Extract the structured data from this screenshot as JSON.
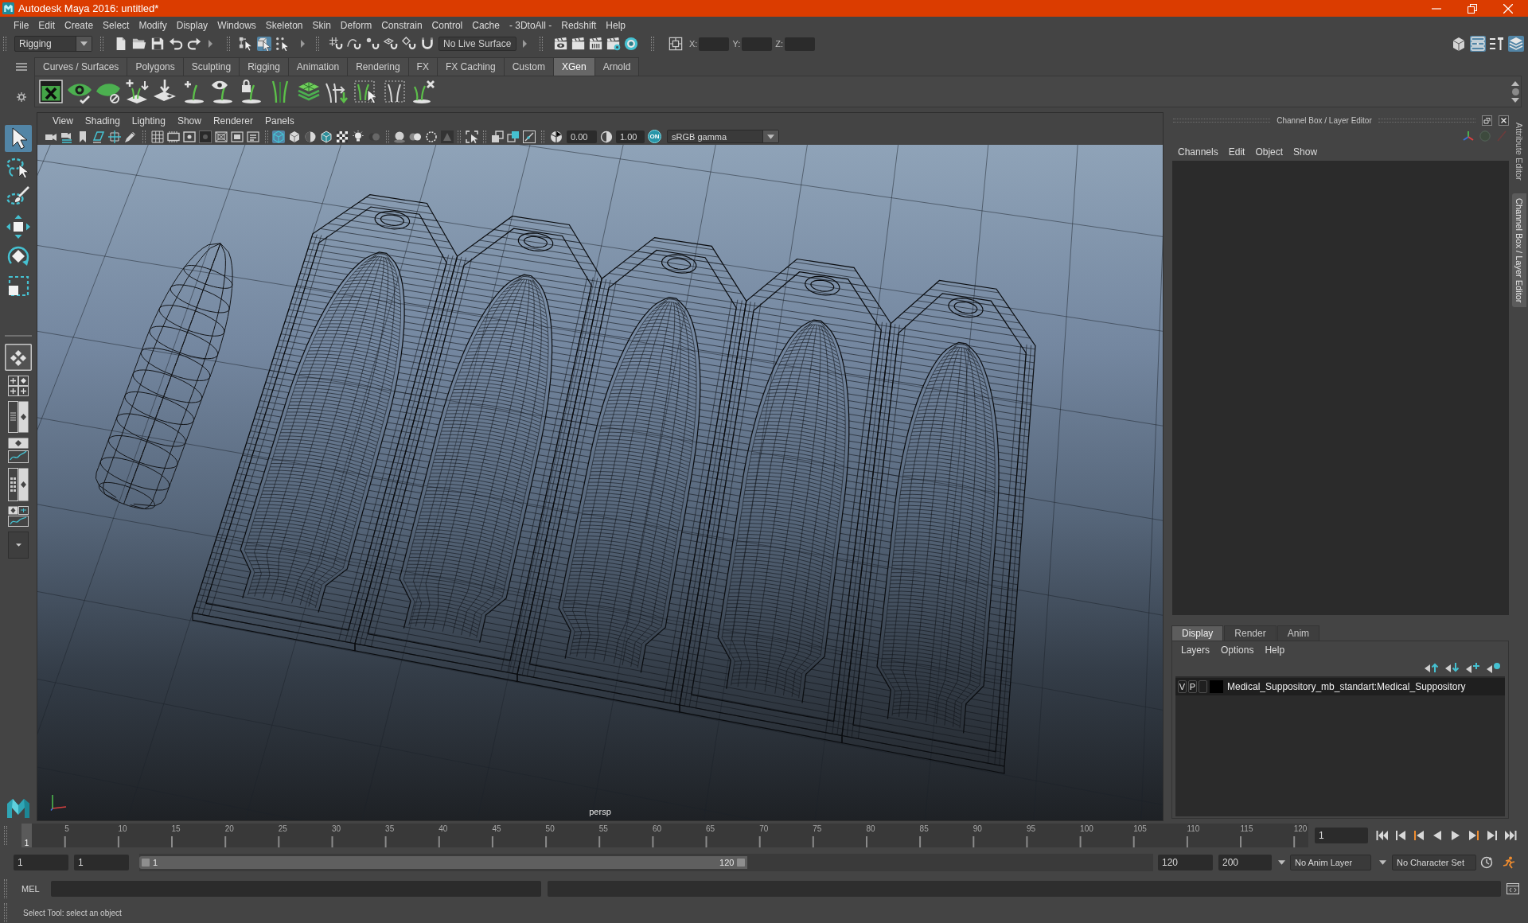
{
  "window": {
    "title": "Autodesk Maya 2016: untitled*"
  },
  "menu_bar": [
    "File",
    "Edit",
    "Create",
    "Select",
    "Modify",
    "Display",
    "Windows",
    "Skeleton",
    "Skin",
    "Deform",
    "Constrain",
    "Control",
    "Cache",
    "- 3DtoAll -",
    "Redshift",
    "Help"
  ],
  "status_line": {
    "menu_set": "Rigging",
    "selection_modes": [
      {
        "selected": false
      },
      {
        "selected": true
      },
      {
        "selected": false
      }
    ],
    "live_surface": "No Live Surface",
    "coordinate_fields": [
      {
        "label": "X:"
      },
      {
        "label": "Y:"
      },
      {
        "label": "Z:"
      }
    ],
    "panel_toggles": [
      {
        "selected": false
      },
      {
        "selected": true
      },
      {
        "selected": false
      },
      {
        "selected": true
      }
    ]
  },
  "shelf": {
    "tabs": [
      {
        "label": "Curves / Surfaces",
        "selected": false
      },
      {
        "label": "Polygons",
        "selected": false
      },
      {
        "label": "Sculpting",
        "selected": false
      },
      {
        "label": "Rigging",
        "selected": false
      },
      {
        "label": "Animation",
        "selected": false
      },
      {
        "label": "Rendering",
        "selected": false
      },
      {
        "label": "FX",
        "selected": false
      },
      {
        "label": "FX Caching",
        "selected": false
      },
      {
        "label": "Custom",
        "selected": false
      },
      {
        "label": "XGen",
        "selected": true
      },
      {
        "label": "Arnold",
        "selected": false
      }
    ]
  },
  "toolbox": {
    "tools": [
      {
        "selected": true
      },
      {
        "selected": false
      },
      {
        "selected": false
      },
      {
        "selected": false
      },
      {
        "selected": false
      },
      {
        "selected": false
      }
    ]
  },
  "viewport": {
    "menu": [
      "View",
      "Shading",
      "Lighting",
      "Show",
      "Renderer",
      "Panels"
    ],
    "toolbar_toggles": [
      {
        "selected": false
      },
      {
        "selected": false
      },
      {
        "selected": false
      },
      {
        "selected": false
      },
      {
        "selected": false
      },
      {
        "selected": false
      },
      {
        "selected": false
      },
      {
        "selected": true
      },
      {
        "selected": false
      },
      {
        "selected": false
      },
      {
        "selected": false
      },
      {
        "selected": false
      },
      {
        "selected": false
      },
      {
        "selected": false
      }
    ],
    "exposure": "0.00",
    "gamma": "1.00",
    "color_management": "ON",
    "view_transform": "sRGB gamma",
    "camera": "persp"
  },
  "channel_box": {
    "title": "Channel Box / Layer Editor",
    "menu": [
      "Channels",
      "Edit",
      "Object",
      "Show"
    ]
  },
  "layer_editor": {
    "tabs": [
      {
        "label": "Display",
        "selected": true
      },
      {
        "label": "Render",
        "selected": false
      },
      {
        "label": "Anim",
        "selected": false
      }
    ],
    "menu": [
      "Layers",
      "Options",
      "Help"
    ],
    "layers": [
      {
        "visibility": "V",
        "playback": "P",
        "color": "#000000",
        "name": "Medical_Suppository_mb_standart:Medical_Suppository"
      }
    ]
  },
  "side_tabs": [
    {
      "label": "Attribute Editor",
      "selected": false
    },
    {
      "label": "Channel Box / Layer Editor",
      "selected": true
    }
  ],
  "time_slider": {
    "current_frame_marker": "1",
    "level": 0,
    "ticks": [
      "5",
      "10",
      "15",
      "20",
      "25",
      "30",
      "35",
      "40",
      "45",
      "50",
      "55",
      "60",
      "65",
      "70",
      "75",
      "80",
      "85",
      "90",
      "95",
      "100",
      "105",
      "110",
      "115",
      "120"
    ],
    "current_frame": "1"
  },
  "range_slider": {
    "start_frame": "1",
    "playback_start": "1",
    "range_start": "1",
    "range_end": "120",
    "level": 0.6,
    "playback_end": "120",
    "end_frame": "200",
    "anim_layer": "No Anim Layer",
    "character_set": "No Character Set"
  },
  "command_line": {
    "language": "MEL"
  },
  "help_line": "Select Tool: select an object"
}
